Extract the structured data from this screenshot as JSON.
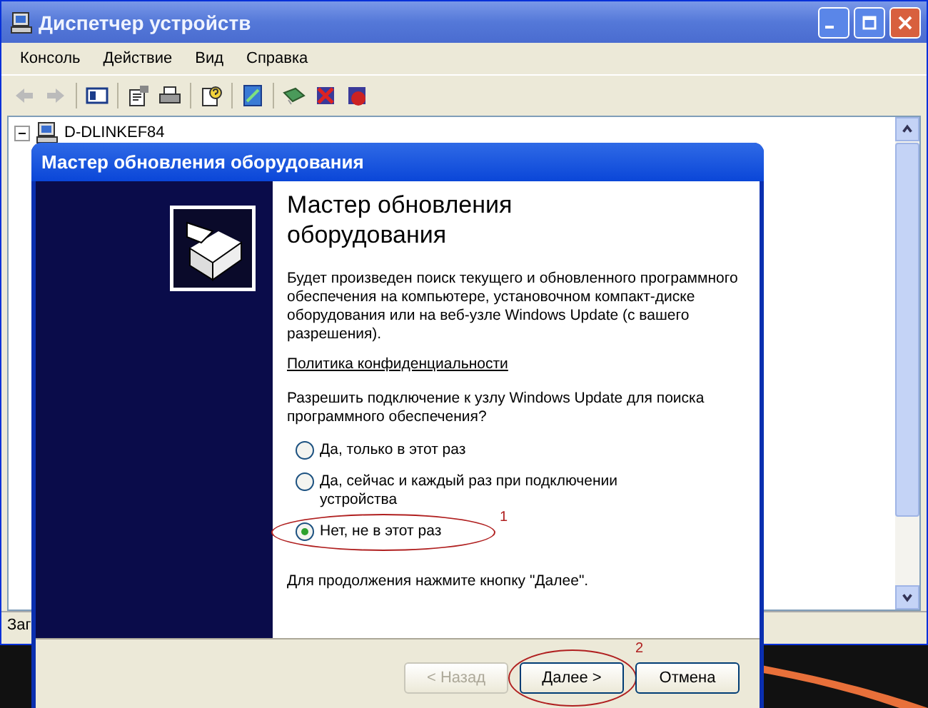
{
  "window": {
    "title": "Диспетчер устройств"
  },
  "menu": [
    "Консоль",
    "Действие",
    "Вид",
    "Справка"
  ],
  "tree": {
    "label": "D-DLINKEF84",
    "expanded": true
  },
  "status_bar": "Заг",
  "dialog": {
    "title": "Мастер обновления оборудования",
    "heading": "Мастер обновления оборудования",
    "description": "Будет произведен поиск текущего и обновленного программного обеспечения на компьютере, установочном компакт-диске оборудования или на веб-узле Windows Update (с вашего разрешения).",
    "link": "Политика конфиденциальности",
    "question": "Разрешить подключение к узлу Windows Update для поиска программного обеспечения?",
    "options": [
      {
        "label": "Да, только в этот раз",
        "selected": false
      },
      {
        "label": "Да, сейчас и каждый раз при подключении устройства",
        "selected": false
      },
      {
        "label": "Нет, не в этот раз",
        "selected": true,
        "annotation": "1"
      }
    ],
    "footer_note": "Для продолжения нажмите кнопку \"Далее\".",
    "buttons": [
      {
        "label": "< Назад",
        "disabled": true
      },
      {
        "label": "Далее >",
        "disabled": false,
        "annotation": "2"
      },
      {
        "label": "Отмена",
        "disabled": false
      }
    ]
  }
}
